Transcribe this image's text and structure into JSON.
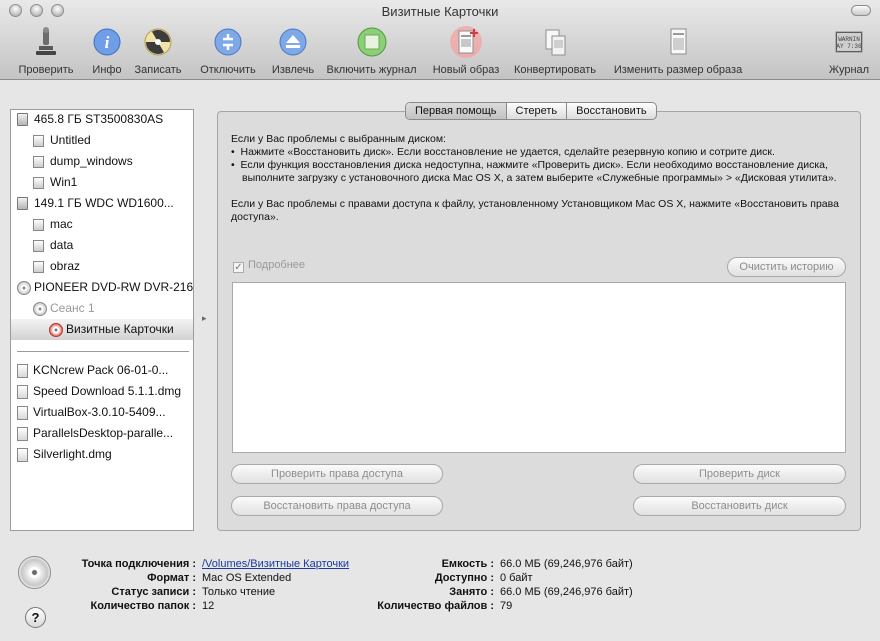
{
  "window": {
    "title": "Визитные Карточки"
  },
  "toolbar": {
    "verify": "Проверить",
    "info": "Инфо",
    "burn": "Записать",
    "unmount": "Отключить",
    "eject": "Извлечь",
    "enable_journal": "Включить журнал",
    "new_image": "Новый образ",
    "convert": "Конвертировать",
    "resize": "Изменить размер образа",
    "log": "Журнал",
    "log_icon_text": "WARNIN\nAY 7:36"
  },
  "sidebar": {
    "items": [
      {
        "label": "465.8 ГБ ST3500830AS",
        "icon": "hard-disk-icon"
      },
      {
        "label": "Untitled",
        "icon": "volume-icon"
      },
      {
        "label": "dump_windows",
        "icon": "volume-icon"
      },
      {
        "label": "Win1",
        "icon": "volume-icon"
      },
      {
        "label": "149.1 ГБ WDC WD1600...",
        "icon": "hard-disk-icon"
      },
      {
        "label": "mac",
        "icon": "volume-icon"
      },
      {
        "label": "data",
        "icon": "volume-icon"
      },
      {
        "label": "obraz",
        "icon": "volume-icon"
      },
      {
        "label": "PIONEER DVD-RW DVR-216",
        "icon": "optical-drive-icon"
      },
      {
        "label": "Сеанс 1",
        "icon": "session-disc-icon"
      },
      {
        "label": "Визитные Карточки",
        "icon": "disc-icon",
        "selected": true
      }
    ],
    "images": [
      {
        "label": "KCNcrew Pack 06-01-0..."
      },
      {
        "label": "Speed Download 5.1.1.dmg"
      },
      {
        "label": "VirtualBox-3.0.10-5409..."
      },
      {
        "label": "ParallelsDesktop-paralle..."
      },
      {
        "label": "Silverlight.dmg"
      }
    ]
  },
  "tabs": {
    "first_aid": "Первая помощь",
    "erase": "Стереть",
    "restore": "Восстановить"
  },
  "first_aid": {
    "intro": "Если у Вас проблемы с выбранным диском:",
    "bullet1": "Нажмите «Восстановить диск». Если восстановление не удается, сделайте резервную копию и сотрите диск.",
    "bullet2": "Если функция восстановления диска недоступна, нажмите «Проверить диск». Если необходимо восстановление диска, выполните загрузку с установочного диска Mac OS X, а затем выберите «Служебные программы» > «Дисковая утилита».",
    "permissions": "Если у Вас проблемы с правами доступа к файлу, установленному Установщиком Mac OS X, нажмите «Восстановить права доступа».",
    "details": "Подробнее",
    "clear_history": "Очистить историю",
    "verify_permissions": "Проверить права доступа",
    "verify_disk": "Проверить диск",
    "repair_permissions": "Восстановить права доступа",
    "repair_disk": "Восстановить диск"
  },
  "details": {
    "mount_point_label": "Точка подключения :",
    "mount_point": "/Volumes/Визитные Карточки",
    "format_label": "Формат :",
    "format": "Mac OS Extended",
    "write_status_label": "Статус записи :",
    "write_status": "Только чтение",
    "folders_label": "Количество папок :",
    "folders": "12",
    "capacity_label": "Емкость :",
    "capacity": "66.0 МБ (69,246,976 байт)",
    "available_label": "Доступно :",
    "available": "0 байт",
    "used_label": "Занято :",
    "used": "66.0 МБ (69,246,976 байт)",
    "files_label": "Количество файлов :",
    "files": "79"
  },
  "colors": {
    "selected_disc": "#d9483b",
    "new_image_highlight": "#f4a3a3",
    "journal_green": "#5fae4e",
    "toolbar_blue": "#5b8fd8"
  }
}
